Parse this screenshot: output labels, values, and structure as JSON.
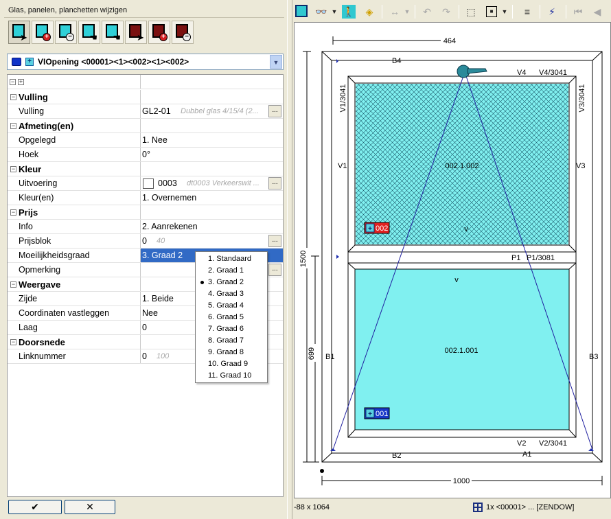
{
  "window_title": "Glas, panelen, planchetten wijzigen",
  "selector": {
    "label": "VIOpening <00001><1><002><1><002>"
  },
  "properties": [
    {
      "type": "cat",
      "label": "Vulling"
    },
    {
      "type": "row",
      "label": "Vulling",
      "value": "GL2-01",
      "hint": "Dubbel glas 4/15/4 (2...",
      "ellipsis": true
    },
    {
      "type": "cat",
      "label": "Afmeting(en)"
    },
    {
      "type": "row",
      "label": "Opgelegd",
      "value": "1. Nee"
    },
    {
      "type": "row",
      "label": "Hoek",
      "value": "0°"
    },
    {
      "type": "cat",
      "label": "Kleur"
    },
    {
      "type": "row",
      "label": "Uitvoering",
      "value": "0003",
      "hint": "dt0003 Verkeerswit ...",
      "ellipsis": true,
      "swatch": true
    },
    {
      "type": "row",
      "label": "Kleur(en)",
      "value": "1. Overnemen"
    },
    {
      "type": "cat",
      "label": "Prijs"
    },
    {
      "type": "row",
      "label": "Info",
      "value": "2. Aanrekenen"
    },
    {
      "type": "row",
      "label": "Prijsblok",
      "value": "0",
      "hint": "40",
      "ellipsis": true
    },
    {
      "type": "row",
      "label": "Moeilijkheidsgraad",
      "value": "3. Graad 2",
      "selected": true
    },
    {
      "type": "row",
      "label": "Opmerking",
      "value": "",
      "ellipsis": true
    },
    {
      "type": "cat",
      "label": "Weergave"
    },
    {
      "type": "row",
      "label": "Zijde",
      "value": "1. Beide"
    },
    {
      "type": "row",
      "label": "Coordinaten vastleggen",
      "value": "Nee"
    },
    {
      "type": "row",
      "label": "Laag",
      "value": "0"
    },
    {
      "type": "cat",
      "label": "Doorsnede"
    },
    {
      "type": "row",
      "label": "Linknummer",
      "value": "0",
      "hint": "100"
    }
  ],
  "dropdown": {
    "selected_index": 2,
    "options": [
      "1. Standaard",
      "2. Graad 1",
      "3. Graad 2",
      "4. Graad 3",
      "5. Graad 4",
      "6. Graad 5",
      "7. Graad 6",
      "8. Graad 7",
      "9. Graad 8",
      "10. Graad 9",
      "11. Graad 10"
    ]
  },
  "buttons": {
    "ok": "✔",
    "cancel": "✕"
  },
  "drawing": {
    "dim_top": "464",
    "dim_bottom": "1000",
    "dim_left_total": "1500",
    "dim_left_lower": "699",
    "labels": {
      "b4": "B4",
      "v4": "V4",
      "v4_full": "V4/3041",
      "v1": "V1",
      "v1_full": "V1/3041",
      "v3": "V3",
      "v3_full": "V3/3041",
      "p1": "P1",
      "p1_full": "P1/3081",
      "b1": "B1",
      "b3": "B3",
      "b2": "B2",
      "a1": "A1",
      "v2": "V2",
      "v2_full": "V2/3041",
      "upper_pane": "002.1.002",
      "lower_pane": "002.1.001",
      "upper_tag": "002",
      "lower_tag": "001",
      "upper_arrow": "v",
      "lower_arrow": "v"
    },
    "colors": {
      "glass": "#80f0f0",
      "tag_red": "#e02020",
      "tag_blue": "#1838c8"
    }
  },
  "status": {
    "coords": "-88 x 1064",
    "info": "1x <00001> ... [ZENDOW]"
  }
}
